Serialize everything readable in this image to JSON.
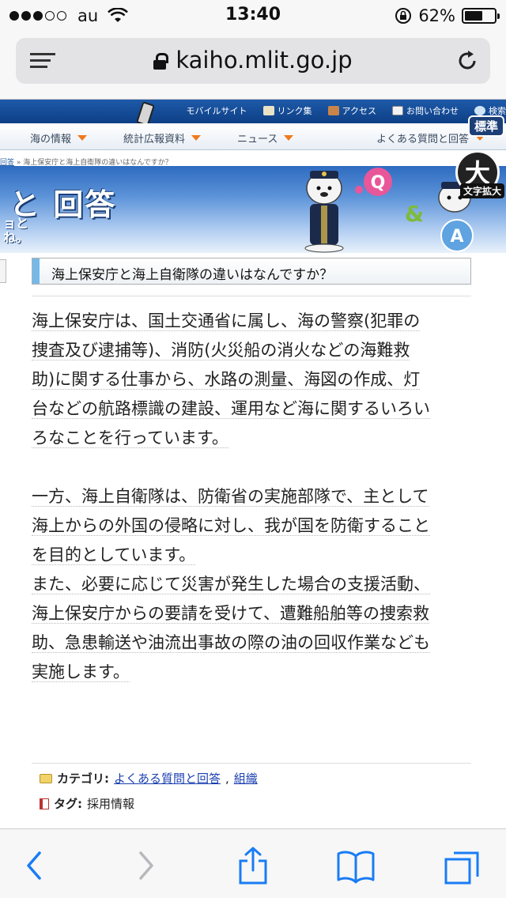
{
  "status_bar": {
    "carrier": "au",
    "time": "13:40",
    "battery": "62%",
    "battery_level": 0.62
  },
  "browser": {
    "url": "kaiho.mlit.go.jp"
  },
  "site": {
    "top_links": [
      "モバイルサイト",
      "リンク集",
      "アクセス",
      "お問い合わせ",
      "検索"
    ],
    "font_size_standard": "標準",
    "menu": [
      "海の情報",
      "統計広報資料",
      "ニュース",
      "よくある質問と回答"
    ],
    "breadcrumb_link": "回答",
    "breadcrumb_sep": " » ",
    "breadcrumb_current": "海上保安庁と海上自衛隊の違いはなんですか？",
    "banner_title": "と 回答",
    "banner_sub_1": "ョと",
    "banner_sub_2": "ね。",
    "zoom_glyph": "大",
    "zoom_label": "文字拡大",
    "q_letter": "Q",
    "amp": "&",
    "a_letter": "A"
  },
  "article": {
    "question": "海上保安庁と海上自衛隊の違いはなんですか？",
    "para1_lines": [
      "海上保安庁は、国土交通省に属し、海の警察(犯罪の",
      "捜査及び逮捕等)、消防(火災船の消火などの海難救",
      "助)に関する仕事から、水路の測量、海図の作成、灯",
      "台などの航路標識の建設、運用など海に関するいろい",
      "ろなことを行っています。"
    ],
    "para2_lines": [
      "一方、海上自衛隊は、防衛省の実施部隊で、主として",
      "海上からの外国の侵略に対し、我が国を防衛すること",
      "を目的としています。"
    ],
    "para3_lines": [
      "また、必要に応じて災害が発生した場合の支援活動、",
      "海上保安庁からの要請を受けて、遭難船舶等の捜索救",
      "助、急患輸送や油流出事故の際の油の回収作業なども",
      "実施します。"
    ],
    "category_label": "カテゴリ:",
    "category_link_1": "よくある質問と回答",
    "category_sep": ",",
    "category_link_2": "組織",
    "tag_label": "タグ:",
    "tag_value": "採用情報"
  },
  "colors": {
    "header_blue": "#1e5aa8",
    "menu_arrow": "#f07a1a",
    "question_accent": "#76b9e8",
    "link": "#1a3fb0",
    "ios_blue": "#1a7cf5"
  },
  "icons": {
    "back": "chevron-left-icon",
    "forward": "chevron-right-icon",
    "share": "share-icon",
    "bookmarks": "book-icon",
    "tabs": "tabs-icon"
  }
}
